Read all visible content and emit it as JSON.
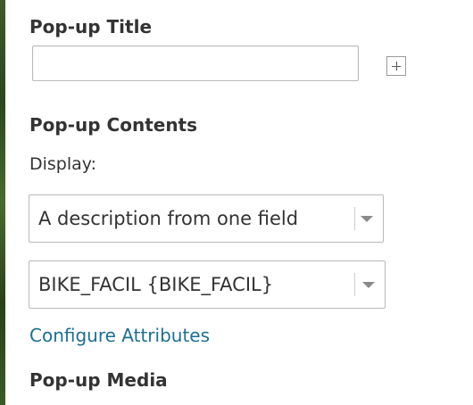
{
  "popup_title": {
    "heading": "Pop-up Title",
    "input_value": "",
    "add_icon": "plus-square-icon"
  },
  "popup_contents": {
    "heading": "Pop-up Contents",
    "display_label": "Display:",
    "display_select": {
      "value": "A description from one field",
      "icon": "chevron-down-icon"
    },
    "field_select": {
      "value": "BIKE_FACIL {BIKE_FACIL}",
      "icon": "chevron-down-icon"
    },
    "configure_link": "Configure Attributes"
  },
  "popup_media": {
    "heading": "Pop-up Media"
  },
  "colors": {
    "text": "#333333",
    "link": "#1d6f92",
    "border": "#b9b9b9"
  }
}
